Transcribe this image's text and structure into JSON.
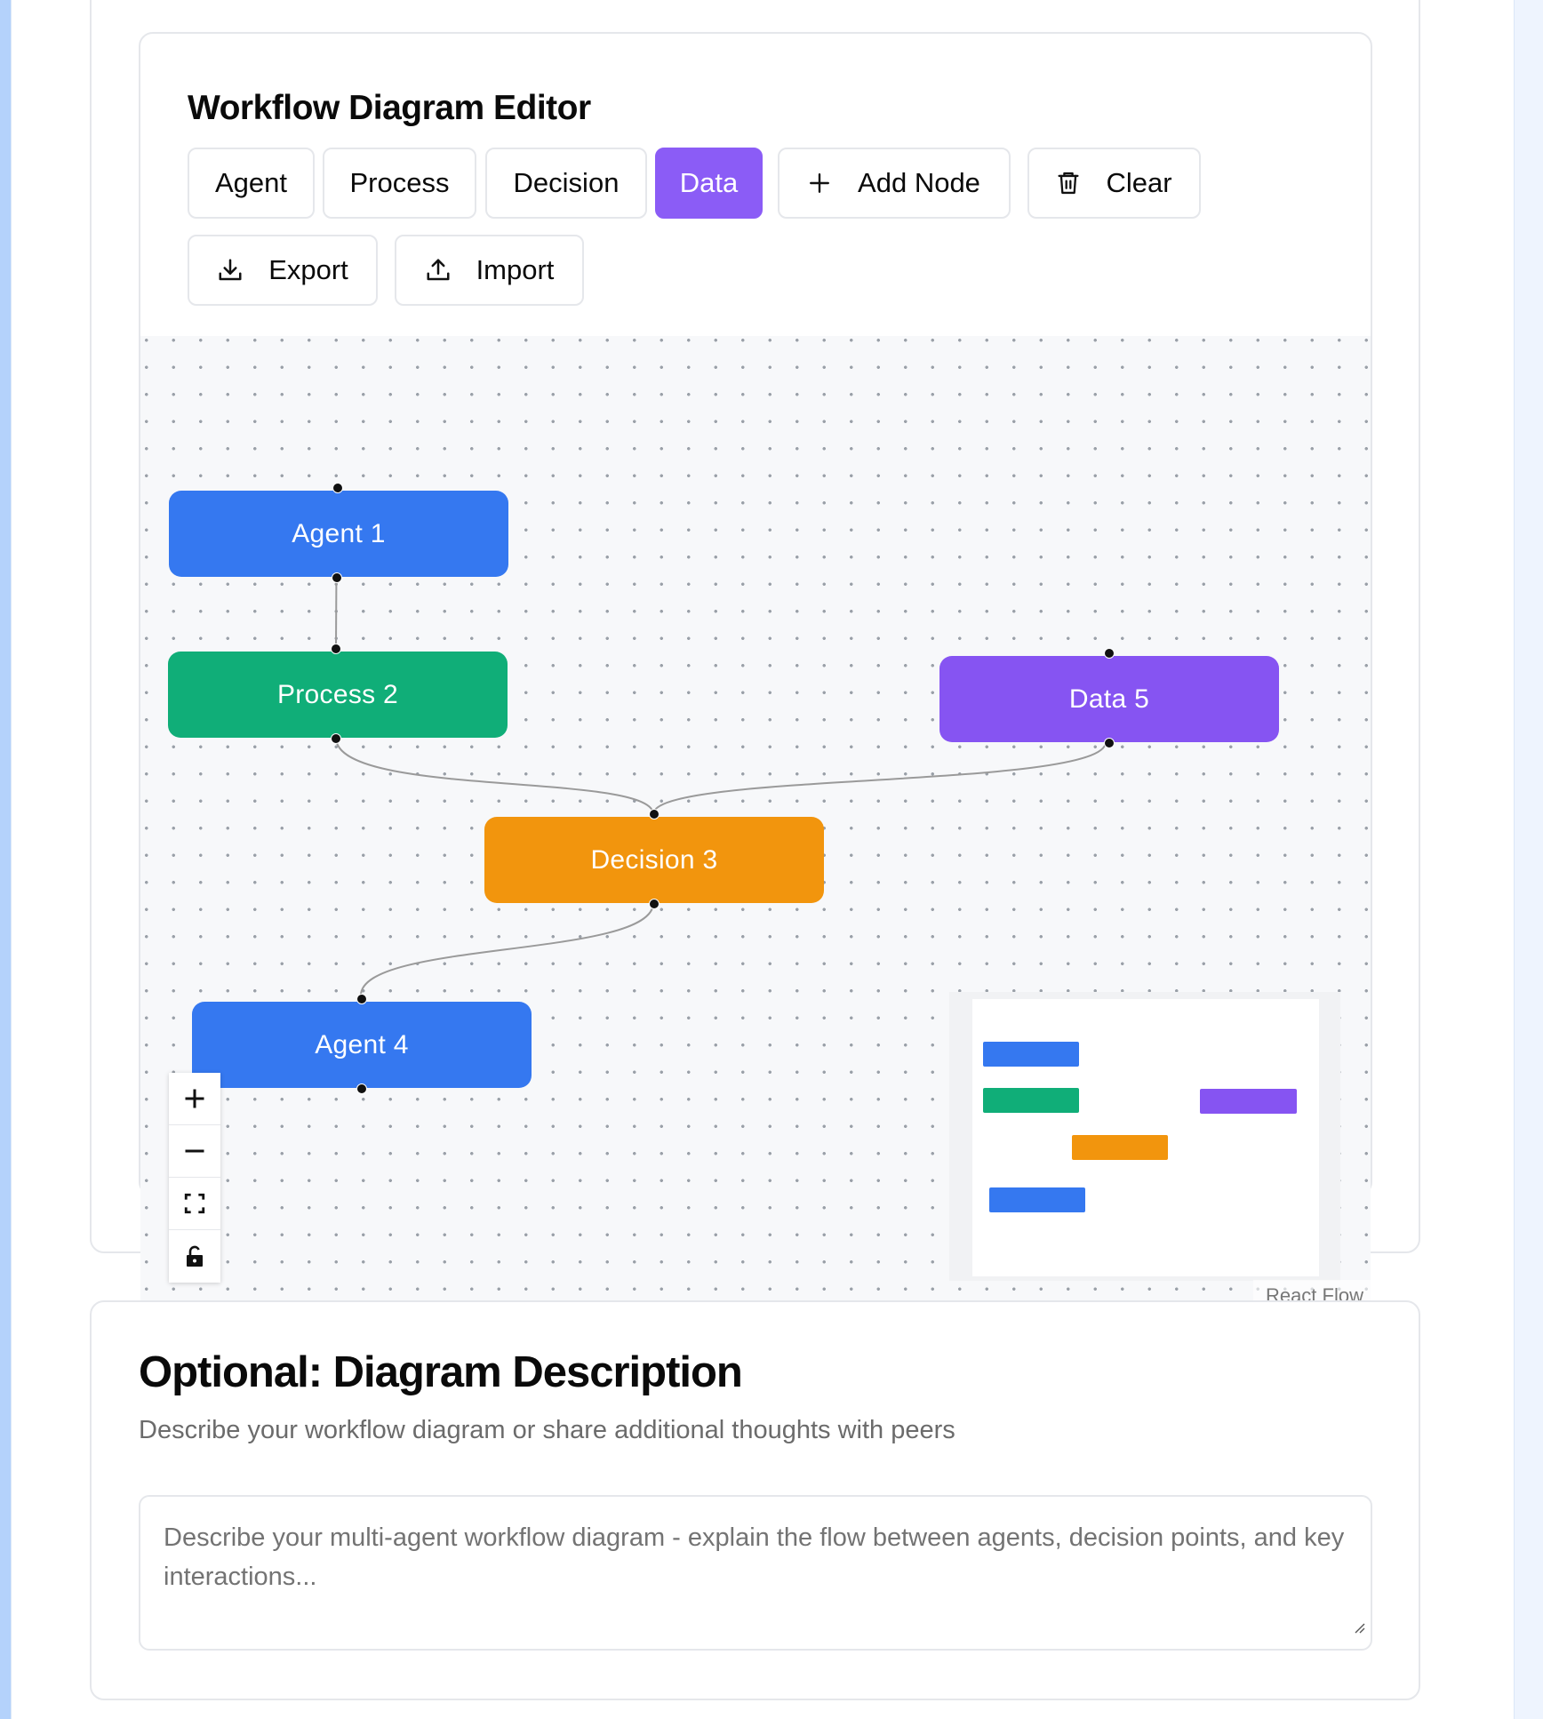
{
  "editor": {
    "title": "Workflow Diagram Editor",
    "toolbar": {
      "agent": "Agent",
      "process": "Process",
      "decision": "Decision",
      "data": "Data",
      "add_node": "Add Node",
      "clear": "Clear",
      "export": "Export",
      "import": "Import"
    },
    "selected_node_type": "Data",
    "accent_color": "#8b5cf6"
  },
  "diagram": {
    "nodes": [
      {
        "id": "1",
        "label": "Agent 1",
        "type": "agent",
        "color": "#3578f0"
      },
      {
        "id": "2",
        "label": "Process 2",
        "type": "process",
        "color": "#10ae78"
      },
      {
        "id": "3",
        "label": "Decision 3",
        "type": "decision",
        "color": "#f2950d"
      },
      {
        "id": "4",
        "label": "Agent 4",
        "type": "agent",
        "color": "#3578f0"
      },
      {
        "id": "5",
        "label": "Data 5",
        "type": "data",
        "color": "#8654f2"
      }
    ],
    "edges": [
      {
        "from": "1",
        "to": "2"
      },
      {
        "from": "2",
        "to": "3"
      },
      {
        "from": "5",
        "to": "3"
      },
      {
        "from": "3",
        "to": "4"
      }
    ],
    "controls": [
      "zoom-in",
      "zoom-out",
      "fit-view",
      "lock"
    ],
    "attribution": "React Flow"
  },
  "description": {
    "title": "Optional: Diagram Description",
    "subtitle": "Describe your workflow diagram or share additional thoughts with peers",
    "placeholder": "Describe your multi-agent workflow diagram - explain the flow between agents, decision points, and key interactions..."
  }
}
